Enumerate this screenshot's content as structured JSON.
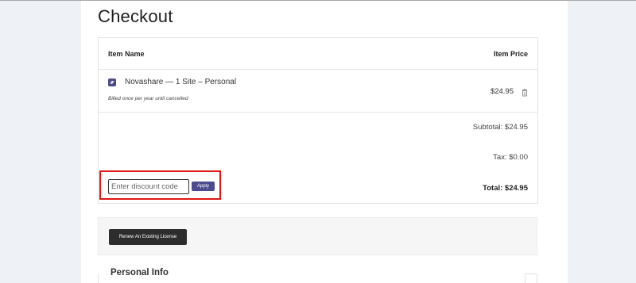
{
  "page": {
    "title": "Checkout"
  },
  "cart": {
    "headers": {
      "item_name": "Item Name",
      "item_price": "Item Price"
    },
    "items": [
      {
        "icon": "product-logo-icon",
        "name": "Novashare — 1 Site – Personal",
        "note": "Billed once per year until cancelled",
        "price": "$24.95",
        "remove_icon": "trash-icon"
      }
    ],
    "subtotal": "Subtotal: $24.95",
    "tax": "Tax: $0.00",
    "total": "Total: $24.95"
  },
  "discount": {
    "placeholder": "Enter discount code",
    "apply_label": "Apply",
    "highlight_color": "#e01515"
  },
  "renew": {
    "button_label": "Renew An Existing License"
  },
  "personal_info": {
    "title": "Personal Info"
  },
  "colors": {
    "accent": "#4b4b8f",
    "dark_button": "#2d2d2d",
    "background": "#eef1f5"
  }
}
